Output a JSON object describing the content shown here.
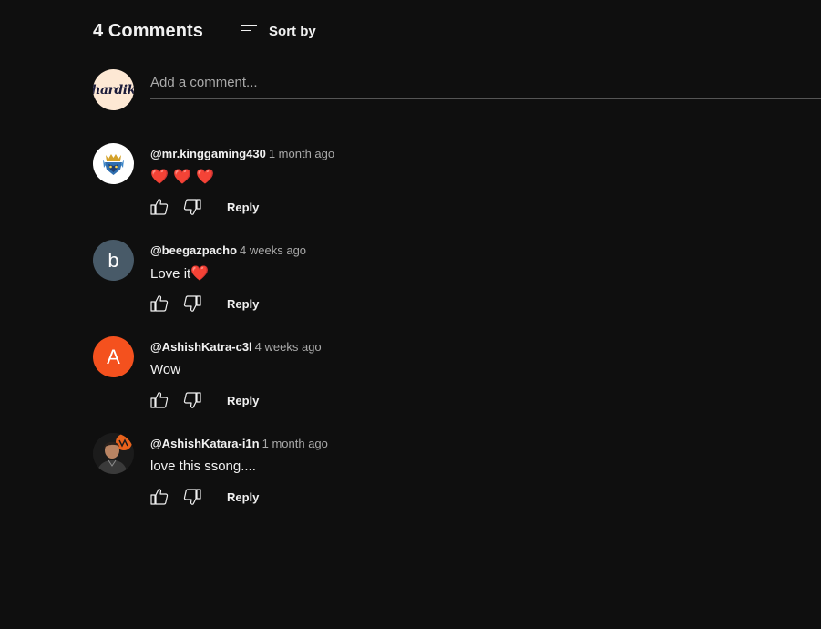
{
  "header": {
    "comment_count_title": "4 Comments",
    "sort_label": "Sort by"
  },
  "add_comment": {
    "placeholder": "Add a comment...",
    "avatar_text": "hardik"
  },
  "comments": [
    {
      "author": "@mr.kinggaming430",
      "time": "1 month ago",
      "text": "❤️ ❤️ ❤️",
      "avatar": "king-gaming-logo",
      "reply_label": "Reply"
    },
    {
      "author": "@beegazpacho",
      "time": "4 weeks ago",
      "text": "Love it",
      "text_emoji": "❤️",
      "avatar_letter": "b",
      "reply_label": "Reply"
    },
    {
      "author": "@AshishKatra-c3l",
      "time": "4 weeks ago",
      "text": "Wow",
      "avatar_letter": "A",
      "reply_label": "Reply"
    },
    {
      "author": "@AshishKatara-i1n",
      "time": "1 month ago",
      "text": "love this ssong....",
      "avatar": "user-photo",
      "reply_label": "Reply"
    }
  ],
  "icons": {
    "sort": "sort-icon",
    "like": "thumbs-up-icon",
    "dislike": "thumbs-down-icon"
  },
  "colors": {
    "background": "#0f0f0f",
    "text": "#f1f1f1",
    "muted": "#aaaaaa",
    "heart": "#e0245e",
    "avatar_b": "#485a68",
    "avatar_a": "#f4511e"
  }
}
